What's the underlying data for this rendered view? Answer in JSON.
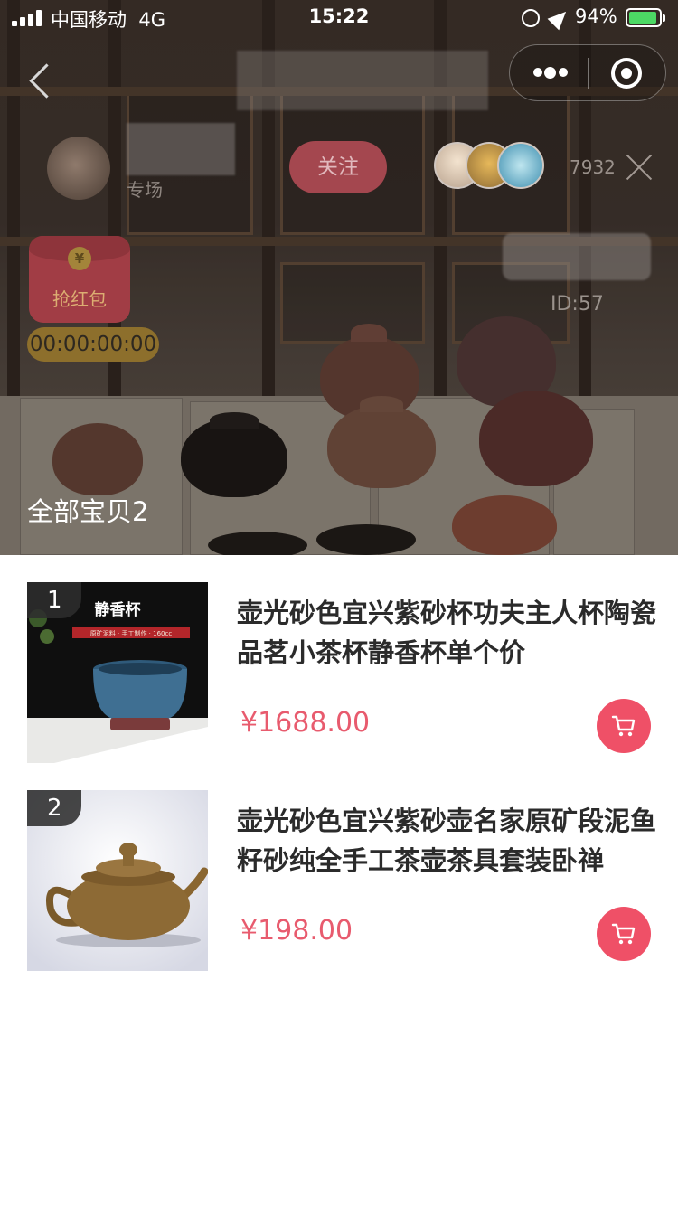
{
  "status_bar": {
    "carrier": "中国移动",
    "network": "4G",
    "time": "15:22",
    "battery": "94%",
    "battery_level": 0.94
  },
  "nav": {
    "back_icon": "chevron-left-icon",
    "more_icon": "more-dots-icon",
    "close_icon": "target-close-icon"
  },
  "room": {
    "host_name": "专场",
    "follow_label": "关注",
    "viewer_count": "7932",
    "room_id": "ID:57",
    "red_packet_label": "抢红包",
    "red_packet_coin": "¥",
    "countdown": "00:00:00:00",
    "section_title": "全部宝贝2"
  },
  "colors": {
    "accent": "#ef5067",
    "price": "#e85b6e",
    "overlay": "#3a2f29"
  },
  "products": [
    {
      "rank": "1",
      "title": "壶光砂色宜兴紫砂杯功夫主人杯陶瓷品茗小茶杯静香杯单个价",
      "price": "¥1688.00",
      "image_caption": "静香杯",
      "image_subcaption": "原矿泥料 · 手工制作 · 160cc",
      "cart_icon": "cart-icon"
    },
    {
      "rank": "2",
      "title": "壶光砂色宜兴紫砂壶名家原矿段泥鱼籽砂纯全手工茶壶茶具套装卧禅",
      "price": "¥198.00",
      "cart_icon": "cart-icon"
    }
  ]
}
